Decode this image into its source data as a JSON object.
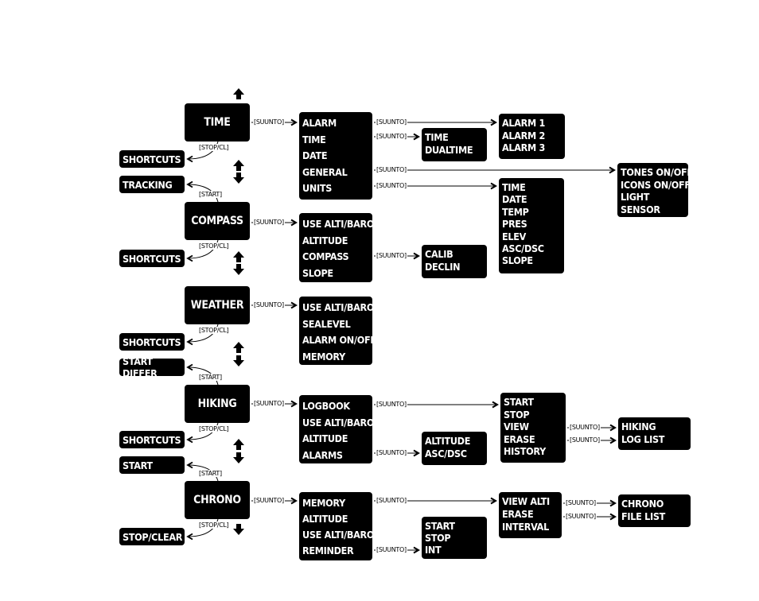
{
  "connectors": {
    "suunto": "[SUUNTO]",
    "stop_cl": "[STOP/CL]",
    "start": "[START]"
  },
  "colors": {
    "box": "#000000",
    "text": "#ffffff",
    "line": "#000000"
  },
  "boxes": [
    {
      "id": "time",
      "kind": "main",
      "lines": [
        "TIME"
      ]
    },
    {
      "id": "time-menu",
      "kind": "list",
      "lines": [
        "ALARM",
        "TIME",
        "DATE",
        "GENERAL",
        "UNITS"
      ]
    },
    {
      "id": "alarms",
      "kind": "list",
      "lines": [
        "ALARM 1",
        "ALARM  2",
        "ALARM 3"
      ]
    },
    {
      "id": "time-dual",
      "kind": "list",
      "lines": [
        "TIME",
        "DUALTIME"
      ]
    },
    {
      "id": "general",
      "kind": "list",
      "lines": [
        "TONES ON/OFF",
        "ICONS ON/OFF",
        "LIGHT",
        "SENSOR"
      ]
    },
    {
      "id": "units",
      "kind": "list",
      "lines": [
        "TIME",
        "DATE",
        "TEMP",
        "PRES",
        "ELEV",
        "ASC/DSC",
        "SLOPE"
      ]
    },
    {
      "id": "shortcuts-1",
      "kind": "side",
      "lines": [
        "SHORTCUTS"
      ]
    },
    {
      "id": "tracking",
      "kind": "side",
      "lines": [
        "TRACKING"
      ]
    },
    {
      "id": "compass",
      "kind": "main",
      "lines": [
        "COMPASS"
      ]
    },
    {
      "id": "compass-menu",
      "kind": "list",
      "lines": [
        "USE ALTI/BARO",
        "ALTITUDE",
        "COMPASS",
        "SLOPE"
      ]
    },
    {
      "id": "calib",
      "kind": "list",
      "lines": [
        "CALIB",
        "DECLIN"
      ]
    },
    {
      "id": "shortcuts-2",
      "kind": "side",
      "lines": [
        "SHORTCUTS"
      ]
    },
    {
      "id": "weather",
      "kind": "main",
      "lines": [
        "WEATHER"
      ]
    },
    {
      "id": "weather-menu",
      "kind": "list",
      "lines": [
        "USE ALTI/BARO",
        "SEALEVEL",
        "ALARM ON/OFF",
        "MEMORY"
      ]
    },
    {
      "id": "shortcuts-3",
      "kind": "side",
      "lines": [
        "SHORTCUTS"
      ]
    },
    {
      "id": "start-differ",
      "kind": "side",
      "lines": [
        "START DIFFER"
      ]
    },
    {
      "id": "hiking",
      "kind": "main",
      "lines": [
        "HIKING"
      ]
    },
    {
      "id": "hiking-menu",
      "kind": "list",
      "lines": [
        "LOGBOOK",
        "USE ALTI/BARO",
        "ALTITUDE",
        "ALARMS"
      ]
    },
    {
      "id": "hiking-alarms",
      "kind": "list",
      "lines": [
        "ALTITUDE",
        "ASC/DSC"
      ]
    },
    {
      "id": "logbook",
      "kind": "list",
      "lines": [
        "START",
        "STOP",
        "VIEW",
        "ERASE",
        "HISTORY"
      ]
    },
    {
      "id": "hiking-log-list",
      "kind": "list",
      "lines": [
        "HIKING",
        "LOG LIST"
      ]
    },
    {
      "id": "shortcuts-4",
      "kind": "side",
      "lines": [
        "SHORTCUTS"
      ]
    },
    {
      "id": "start",
      "kind": "side",
      "lines": [
        "START"
      ]
    },
    {
      "id": "chrono",
      "kind": "main",
      "lines": [
        "CHRONO"
      ]
    },
    {
      "id": "chrono-menu",
      "kind": "list",
      "lines": [
        "MEMORY",
        "ALTITUDE",
        "USE ALTI/BARO",
        "REMINDER"
      ]
    },
    {
      "id": "reminder",
      "kind": "list",
      "lines": [
        "START",
        "STOP",
        "INT"
      ]
    },
    {
      "id": "memory",
      "kind": "list",
      "lines": [
        "VIEW ALTI",
        "ERASE",
        "INTERVAL"
      ]
    },
    {
      "id": "chrono-file-list",
      "kind": "list",
      "lines": [
        "CHRONO",
        "FILE LIST"
      ]
    },
    {
      "id": "stop-clear",
      "kind": "side",
      "lines": [
        "STOP/CLEAR"
      ]
    }
  ]
}
